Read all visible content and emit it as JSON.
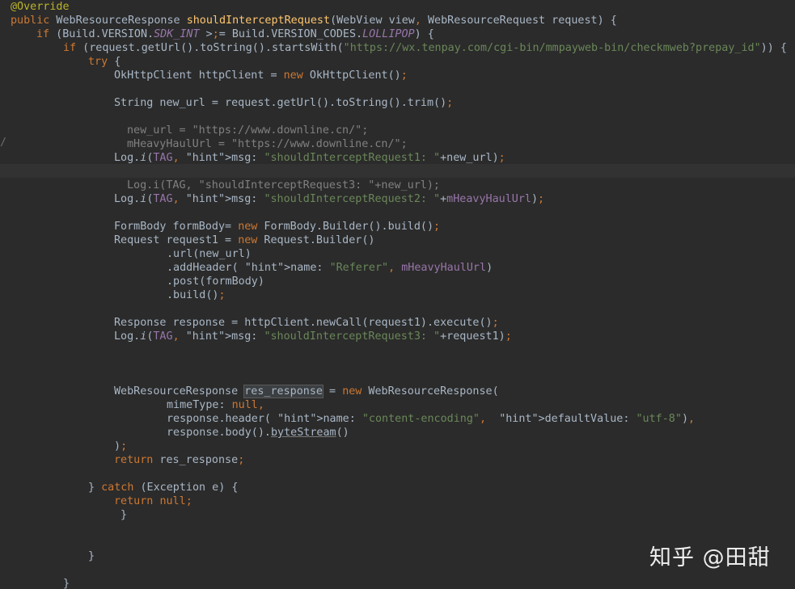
{
  "code_lines": [
    {
      "text": "@Override"
    },
    {
      "text": "public WebResourceResponse shouldInterceptRequest(WebView view, WebResourceRequest request) {"
    },
    {
      "text": "if (Build.VERSION.SDK_INT >= Build.VERSION_CODES.LOLLIPOP) {"
    },
    {
      "text": "if (request.getUrl().toString().startsWith(\"https://wx.tenpay.com/cgi-bin/mmpayweb-bin/checkmweb?prepay_id\")) {"
    },
    {
      "text": "try {"
    },
    {
      "text": "OkHttpClient httpClient = new OkHttpClient();"
    },
    {
      "text": ""
    },
    {
      "text": "String new_url = request.getUrl().toString().trim();"
    },
    {
      "text": ""
    },
    {
      "text": "new_url = \"https://www.downline.cn/\";"
    },
    {
      "text": "mHeavyHaulUrl = \"https://www.downline.cn/\";"
    },
    {
      "text": "Log.i(TAG, msg: \"shouldInterceptRequest1: \"+new_url);"
    },
    {
      "text": ""
    },
    {
      "text": "Log.i(TAG, \"shouldInterceptRequest3: \"+new_url);"
    },
    {
      "text": "Log.i(TAG, msg: \"shouldInterceptRequest2: \"+mHeavyHaulUrl);"
    },
    {
      "text": ""
    },
    {
      "text": "FormBody formBody= new FormBody.Builder().build();"
    },
    {
      "text": "Request request1 = new Request.Builder()"
    },
    {
      "text": ".url(new_url)"
    },
    {
      "text": ".addHeader( name: \"Referer\", mHeavyHaulUrl)"
    },
    {
      "text": ".post(formBody)"
    },
    {
      "text": ".build();"
    },
    {
      "text": ""
    },
    {
      "text": "Response response = httpClient.newCall(request1).execute();"
    },
    {
      "text": "Log.i(TAG, msg: \"shouldInterceptRequest3: \"+request1);"
    },
    {
      "text": ""
    },
    {
      "text": ""
    },
    {
      "text": ""
    },
    {
      "text": "WebResourceResponse res_response = new WebResourceResponse("
    },
    {
      "text": "mimeType: null,"
    },
    {
      "text": "response.header( name: \"content-encoding\",  defaultValue: \"utf-8\"),"
    },
    {
      "text": "response.body().byteStream()"
    },
    {
      "text": ");"
    },
    {
      "text": "return res_response;"
    },
    {
      "text": ""
    },
    {
      "text": "} catch (Exception e) {"
    },
    {
      "text": "return null;"
    },
    {
      "text": "}"
    },
    {
      "text": ""
    },
    {
      "text": ""
    },
    {
      "text": "}"
    },
    {
      "text": ""
    },
    {
      "text": "}"
    }
  ],
  "gutter_mark": "/",
  "watermark": "知乎 @田甜",
  "colors": {
    "background": "#2b2b2b",
    "current_line": "#323232",
    "keyword": "#cc7832",
    "annotation": "#bbb529",
    "method_declaration": "#ffc66d",
    "string": "#6a8759",
    "static_field": "#9876aa",
    "comment": "#808080",
    "default_text": "#a9b7c6"
  }
}
